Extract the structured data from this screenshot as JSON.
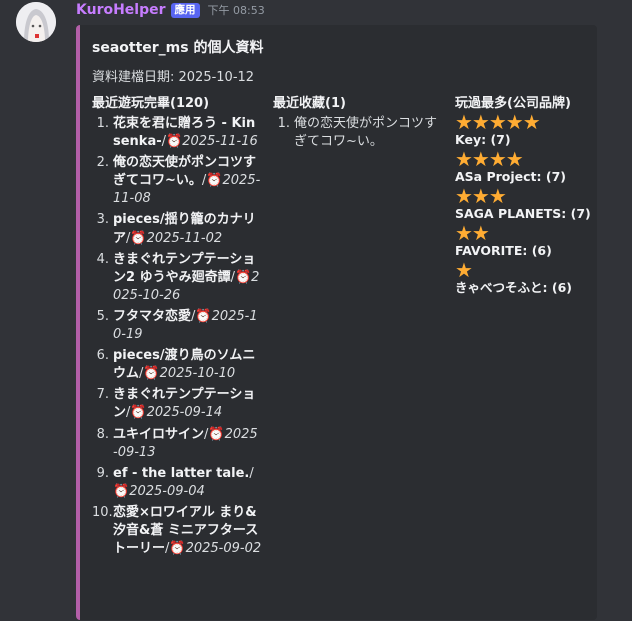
{
  "message": {
    "username": "KuroHelper",
    "badge": "應用",
    "timestamp": "下午 08:53"
  },
  "embed": {
    "accent_color": "#b35fa8",
    "title": "seaotter_ms 的個人資料",
    "created": "資料建檔日期: 2025-10-12",
    "recent_played": {
      "name": "最近遊玩完畢(120)",
      "items": [
        {
          "num": "1.",
          "title": "花束を君に贈ろう - Kinsenka-",
          "sep": "/",
          "icon": "⏰",
          "date": "2025-11-16"
        },
        {
          "num": "2.",
          "title": "俺の恋天使がポンコツすぎてコワ~い。",
          "sep": "/",
          "icon": "⏰",
          "date": "2025-11-08"
        },
        {
          "num": "3.",
          "title": "pieces/揺り籠のカナリア",
          "sep": "/",
          "icon": "⏰",
          "date": "2025-11-02"
        },
        {
          "num": "4.",
          "title": "きまぐれテンプテーション2 ゆうやみ廻奇譚",
          "sep": "/",
          "icon": "⏰",
          "date": "2025-10-26"
        },
        {
          "num": "5.",
          "title": "フタマタ恋愛",
          "sep": "/",
          "icon": "⏰",
          "date": "2025-10-19"
        },
        {
          "num": "6.",
          "title": "pieces/渡り鳥のソムニウム",
          "sep": "/",
          "icon": "⏰",
          "date": "2025-10-10"
        },
        {
          "num": "7.",
          "title": "きまぐれテンプテーション",
          "sep": "/",
          "icon": "⏰",
          "date": "2025-09-14"
        },
        {
          "num": "8.",
          "title": "ユキイロサイン",
          "sep": "/",
          "icon": "⏰",
          "date": "2025-09-13"
        },
        {
          "num": "9.",
          "title": "ef - the latter tale.",
          "sep": "/",
          "icon": "⏰",
          "date": "2025-09-04"
        },
        {
          "num": "10.",
          "title": "恋愛×ロワイアル まり&汐音&蒼 ミニアフターストーリー",
          "sep": "/",
          "icon": "⏰",
          "date": "2025-09-02"
        }
      ]
    },
    "recent_favorites": {
      "name": "最近收藏(1)",
      "items": [
        {
          "num": "1.",
          "title": "俺の恋天使がポンコツすぎてコワ~い。"
        }
      ]
    },
    "top_brands": {
      "name": "玩過最多(公司品牌)",
      "items": [
        {
          "stars": "★★★★★",
          "rating": 5,
          "label": "Key: (7)"
        },
        {
          "stars": "★★★★",
          "rating": 4,
          "label": "ASa Project: (7)"
        },
        {
          "stars": "★★★",
          "rating": 3,
          "label": "SAGA PLANETS: (7)"
        },
        {
          "stars": "★★",
          "rating": 2,
          "label": "FAVORITE: (6)"
        },
        {
          "stars": "★",
          "rating": 1,
          "label": "きゃべつそふと: (6)"
        }
      ]
    }
  }
}
